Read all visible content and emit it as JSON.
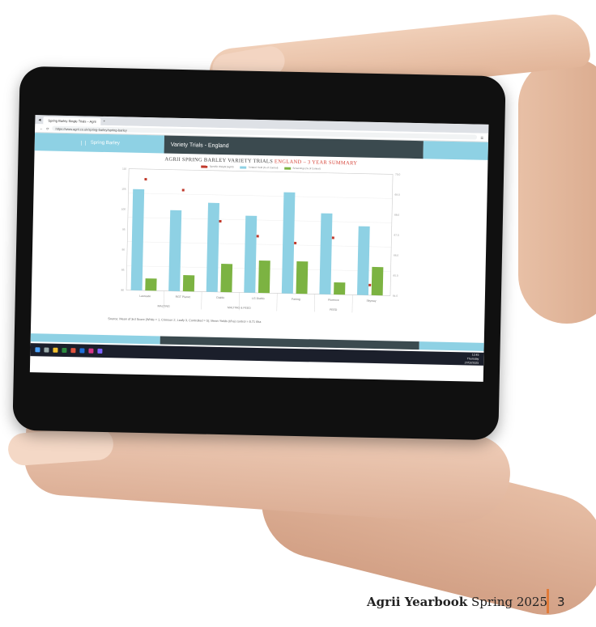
{
  "browser": {
    "tab_title": "Spring Barley Single Trials – Agrii",
    "url": "https://www.agrii.co.uk/spring-barley/spring-barley"
  },
  "app": {
    "section_label": "Spring Barley",
    "page_title": "Variety Trials - England"
  },
  "chart_data": {
    "type": "bar",
    "title_prefix": "AGRII SPRING BARLEY VARIETY TRIALS",
    "title_region": "ENGLAND",
    "title_suffix": "– 3 YEAR SUMMARY",
    "legend": [
      {
        "label": "Specific Weight (kg/hl)",
        "color": "#c0392b"
      },
      {
        "label": "Treated Yield (% of Control)",
        "color": "#8ed1e4"
      },
      {
        "label": "Screenings (% of Control)",
        "color": "#7cb342"
      }
    ],
    "categories": [
      "Laureate",
      "RGT Planet",
      "Diablo",
      "LG Diablo",
      "Fairing",
      "Florence",
      "Skyway"
    ],
    "groups": [
      "MALTING",
      "MALTING & FEED",
      "FEED"
    ],
    "series": [
      {
        "name": "Treated Yield (% of Control)",
        "color": "#8ed1e4",
        "values": [
          105,
          100,
          102,
          99,
          105,
          100,
          97
        ]
      },
      {
        "name": "Screenings (% of Control)",
        "color": "#7cb342",
        "values": [
          3,
          4,
          7,
          8,
          8,
          3,
          7
        ]
      }
    ],
    "markers": [
      69.5,
      69.0,
      67.5,
      66.8,
      66.5,
      66.8,
      64.5
    ],
    "ylim": [
      80,
      110
    ],
    "y2lim": [
      64,
      70
    ]
  },
  "source_note": "Source: Mean of 3rd Score (White = 1, Crimson 2, Leafy 3, Controlled = 5); Mean Yields (t/ha) control = 8.71 t/ha",
  "taskbar": {
    "time": "12:45",
    "day": "Thursday",
    "date": "27/02/2025"
  },
  "footer": {
    "brand": "Agrii Yearbook",
    "edition": "Spring 2025",
    "page": "3"
  }
}
